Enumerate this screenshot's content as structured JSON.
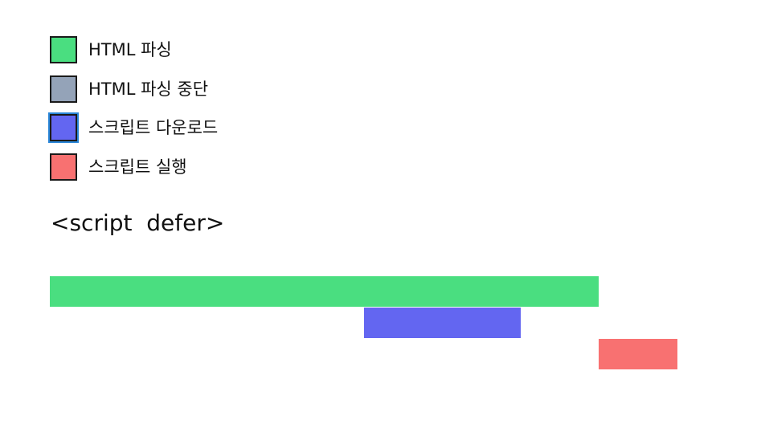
{
  "legend": {
    "items": [
      {
        "label": "HTML 파싱",
        "color": "#4ade80"
      },
      {
        "label": "HTML 파싱 중단",
        "color": "#94a3b8"
      },
      {
        "label": "스크립트 다운로드",
        "color": "#6366f1"
      },
      {
        "label": "스크립트 실행",
        "color": "#f87171"
      }
    ]
  },
  "title": "<script  defer>"
}
